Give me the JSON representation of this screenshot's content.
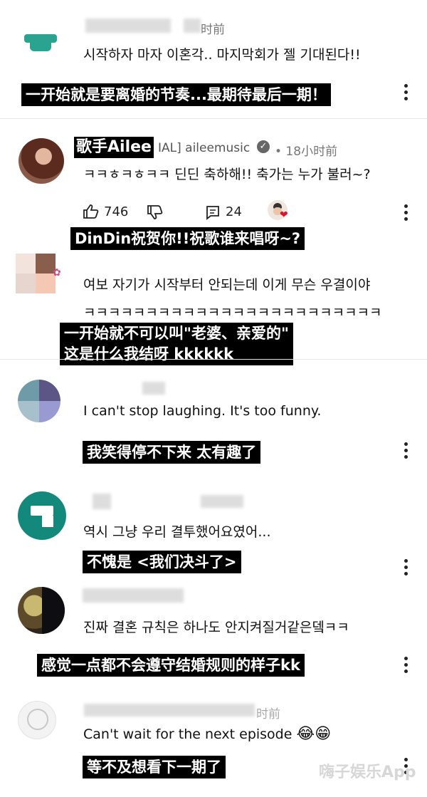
{
  "comments": [
    {
      "time": "时前",
      "text": "시작하자 마자 이혼각.. 마지막회가 젤 기대된다!!",
      "caption": "一开始就是要离婚的节奏...最期待最后一期！"
    },
    {
      "overlay_name": "歌手Ailee",
      "channel": "IAL] aileemusic",
      "time": "• 18小时前",
      "text": "ㅋㅋㅎㅋㅎㅋㅋ 딘딘 축하해!! 축가는 누가 불러~?",
      "likes": "746",
      "replies": "24",
      "caption": "DinDin祝贺你!!祝歌谁来唱呀~?"
    },
    {
      "text": "여보 자기가 시작부터 안되는데 이게 무슨 우결이야",
      "text2": "ㅋㅋㅋㅋㅋㅋㅋㅋㅋㅋㅋㅋㅋㅋㅋㅋㅋㅋㅋㅋㅋㅋㅋㅋ",
      "caption_line1": "一开始就不可以叫\"老婆、亲爱的\"",
      "caption_line2": "这是什么我结呀  kkkkkk"
    },
    {
      "text": "I can't stop laughing. It's too funny.",
      "caption": "我笑得停不下来  太有趣了"
    },
    {
      "text": "역시 그냥 우리 결투했어요였어...",
      "caption": "不愧是 <我们决斗了>"
    },
    {
      "text": "진짜 결혼 규칙은 하나도 안지켜질거같은뎈ㅋㅋ",
      "caption": "感觉一点都不会遵守结婚规则的样子kk"
    },
    {
      "text": "Can't wait for the next episode",
      "emoji": "😂😁",
      "time": "时前",
      "caption": "等不及想看下一期了"
    }
  ],
  "watermark": "嗨子娱乐App"
}
